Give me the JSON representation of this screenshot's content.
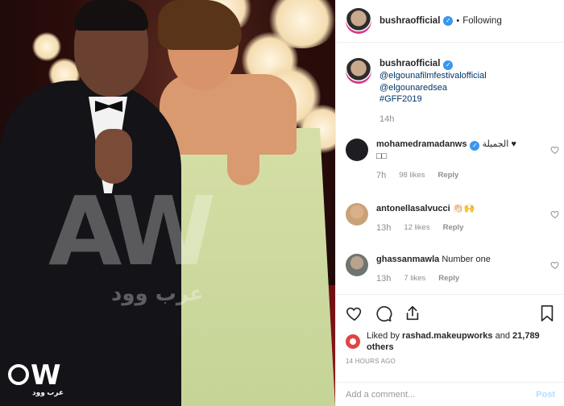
{
  "photo": {
    "watermark_text": "AW",
    "watermark_arabic": "عرب وود",
    "logo_text": "W",
    "logo_sub": "عرب وود"
  },
  "header": {
    "username": "bushraofficial",
    "verified_glyph": "✓",
    "separator": "•",
    "follow_status": "Following"
  },
  "caption": {
    "username": "bushraofficial",
    "mentions": [
      "@elgounafilmfestivalofficial",
      "@elgounaredsea"
    ],
    "hashtag": "#GFF2019",
    "age": "14h"
  },
  "comments": [
    {
      "username": "mohamedramadanws",
      "text": "الجميلة ♥",
      "text_line2": "□□",
      "age": "7h",
      "likes": "98 likes",
      "reply": "Reply",
      "avatar_color": "#1e1e22"
    },
    {
      "username": "antonellasalvucci",
      "text": "👏🏻🙌",
      "text_line2": "",
      "age": "13h",
      "likes": "12 likes",
      "reply": "Reply",
      "avatar_color": "#c9a27a"
    },
    {
      "username": "ghassanmawla",
      "text": "Number one",
      "text_line2": "",
      "age": "13h",
      "likes": "7 likes",
      "reply": "Reply",
      "avatar_color": "#8a8f8a"
    }
  ],
  "actions": {
    "icons": [
      "heart-icon",
      "comment-icon",
      "share-icon",
      "bookmark-icon"
    ],
    "liked_prefix": "Liked by",
    "liked_user": "rashad.makeupworks",
    "liked_and": "and",
    "liked_count": "21,789 others",
    "timestamp": "14 HOURS AGO"
  },
  "add_comment": {
    "placeholder": "Add a comment...",
    "post_label": "Post"
  },
  "colors": {
    "link": "#003569",
    "verified": "#3897f0",
    "muted": "#8e8e8e",
    "post_disabled": "#b2dffc"
  }
}
